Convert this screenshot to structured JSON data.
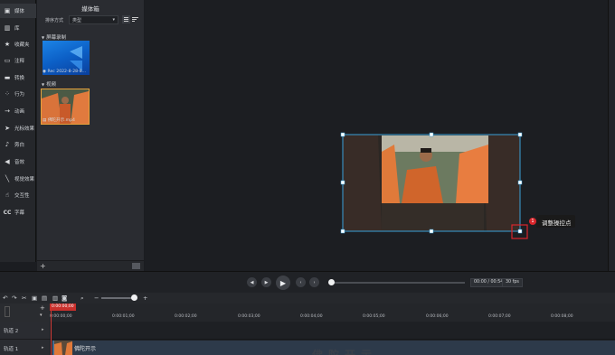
{
  "sidebar": {
    "items": [
      {
        "label": "媒体",
        "icon": "media-icon"
      },
      {
        "label": "库",
        "icon": "library-icon"
      },
      {
        "label": "收藏夹",
        "icon": "star-icon"
      },
      {
        "label": "注释",
        "icon": "annotation-icon"
      },
      {
        "label": "转换",
        "icon": "transition-icon"
      },
      {
        "label": "行为",
        "icon": "behavior-icon"
      },
      {
        "label": "动画",
        "icon": "animation-icon"
      },
      {
        "label": "光标效果",
        "icon": "cursor-icon"
      },
      {
        "label": "旁白",
        "icon": "microphone-icon"
      },
      {
        "label": "音效",
        "icon": "speaker-icon"
      },
      {
        "label": "视觉效果",
        "icon": "wand-icon"
      },
      {
        "label": "交互性",
        "icon": "interactive-icon"
      },
      {
        "label": "字幕",
        "icon": "caption-icon"
      }
    ]
  },
  "media_bin": {
    "title": "媒体箱",
    "sort_label": "排序方式",
    "sort_value": "类型",
    "sections": [
      {
        "label": "屏幕录制",
        "items": [
          {
            "name": "Rec 2022-8-28-8..."
          }
        ]
      },
      {
        "label": "视频",
        "items": [
          {
            "name": "佛陀开示.mp4"
          }
        ]
      }
    ]
  },
  "canvas": {
    "callout": {
      "number": "1",
      "text": "调整操控点"
    }
  },
  "playback": {
    "time": "00:00 / 00:54",
    "fps": "30 fps"
  },
  "timeline": {
    "playhead_time": "0:00:00;00",
    "ticks": [
      "0:00:00;00",
      "0:00:01;00",
      "0:00:02;00",
      "0:00:03;00",
      "0:00:04;00",
      "0:00:05;00",
      "0:00:06;00",
      "0:00:07;00",
      "0:00:08;00"
    ],
    "tracks": [
      {
        "name": "轨道 2"
      },
      {
        "name": "轨道 1"
      }
    ],
    "clip_label": "佛陀开示",
    "watermark": "佛陀开示"
  },
  "colors": {
    "accent_red": "#d9262c",
    "selection_blue": "#3aa0d8",
    "thumb_highlight": "#e8a23a"
  }
}
